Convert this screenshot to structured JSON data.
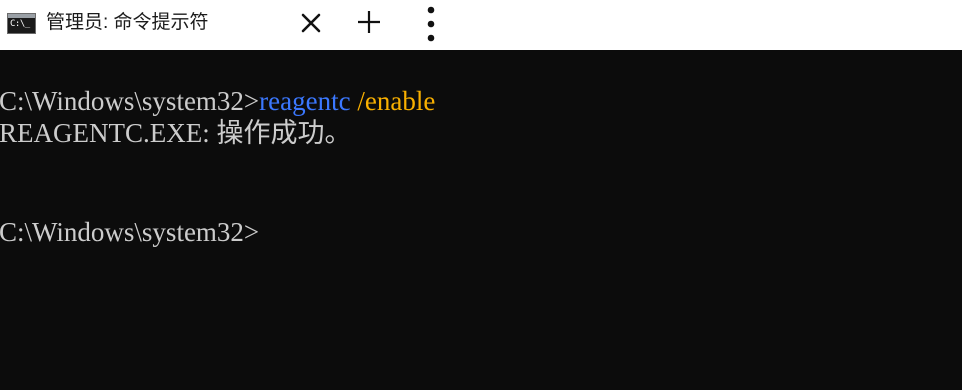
{
  "window": {
    "tab_title": "管理员: 命令提示符",
    "tab_icon_text": "C:\\_",
    "tab_icon": "cmd-window-icon",
    "close_icon": "close-icon",
    "new_tab_icon": "plus-icon",
    "menu_icon": "more-vertical-icon"
  },
  "terminal": {
    "prompt": "C:\\Windows\\system32>",
    "command": "reagentc",
    "argument": "/enable",
    "output": "REAGENTC.EXE: 操作成功。",
    "prompt2": "C:\\Windows\\system32>"
  },
  "colors": {
    "background": "#0c0c0c",
    "text": "#cccccc",
    "command": "#3b78ff",
    "argument": "#f9b000",
    "tabbar": "#ffffff"
  }
}
